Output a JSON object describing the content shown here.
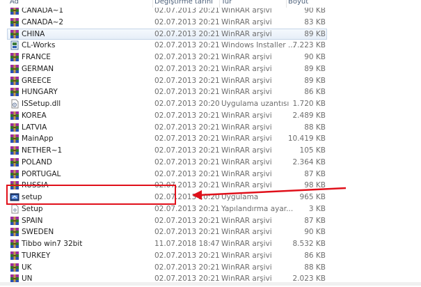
{
  "columns": {
    "name": "Ad",
    "date": "Değiştirme tarihi",
    "type": "Tür",
    "size": "Boyut"
  },
  "files": [
    {
      "name": "CANADA~1",
      "date": "02.07.2013 20:21",
      "type": "WinRAR arşivi",
      "size": "90 KB",
      "icon": "winrar-icon"
    },
    {
      "name": "CANADA~2",
      "date": "02.07.2013 20:21",
      "type": "WinRAR arşivi",
      "size": "83 KB",
      "icon": "winrar-icon"
    },
    {
      "name": "CHINA",
      "date": "02.07.2013 20:21",
      "type": "WinRAR arşivi",
      "size": "89 KB",
      "icon": "winrar-icon"
    },
    {
      "name": "CL-Works",
      "date": "02.07.2013 20:21",
      "type": "Windows Installer ...",
      "size": "7.223 KB",
      "icon": "installer-icon"
    },
    {
      "name": "FRANCE",
      "date": "02.07.2013 20:21",
      "type": "WinRAR arşivi",
      "size": "90 KB",
      "icon": "winrar-icon"
    },
    {
      "name": "GERMAN",
      "date": "02.07.2013 20:21",
      "type": "WinRAR arşivi",
      "size": "89 KB",
      "icon": "winrar-icon"
    },
    {
      "name": "GREECE",
      "date": "02.07.2013 20:21",
      "type": "WinRAR arşivi",
      "size": "89 KB",
      "icon": "winrar-icon"
    },
    {
      "name": "HUNGARY",
      "date": "02.07.2013 20:21",
      "type": "WinRAR arşivi",
      "size": "86 KB",
      "icon": "winrar-icon"
    },
    {
      "name": "ISSetup.dll",
      "date": "02.07.2013 20:20",
      "type": "Uygulama uzantısı",
      "size": "1.720 KB",
      "icon": "dll-icon"
    },
    {
      "name": "KOREA",
      "date": "02.07.2013 20:21",
      "type": "WinRAR arşivi",
      "size": "2.489 KB",
      "icon": "winrar-icon"
    },
    {
      "name": "LATVIA",
      "date": "02.07.2013 20:21",
      "type": "WinRAR arşivi",
      "size": "88 KB",
      "icon": "winrar-icon"
    },
    {
      "name": "MainApp",
      "date": "02.07.2013 20:21",
      "type": "WinRAR arşivi",
      "size": "10.419 KB",
      "icon": "winrar-icon"
    },
    {
      "name": "NETHER~1",
      "date": "02.07.2013 20:21",
      "type": "WinRAR arşivi",
      "size": "105 KB",
      "icon": "winrar-icon"
    },
    {
      "name": "POLAND",
      "date": "02.07.2013 20:21",
      "type": "WinRAR arşivi",
      "size": "2.364 KB",
      "icon": "winrar-icon"
    },
    {
      "name": "PORTUGAL",
      "date": "02.07.2013 20:21",
      "type": "WinRAR arşivi",
      "size": "87 KB",
      "icon": "winrar-icon"
    },
    {
      "name": "RUSSIA",
      "date": "02.07.2013 20:21",
      "type": "WinRAR arşivi",
      "size": "98 KB",
      "icon": "winrar-icon"
    },
    {
      "name": "setup",
      "date": "02.07.2013 20:20",
      "type": "Uygulama",
      "size": "965 KB",
      "icon": "setup-exe-icon"
    },
    {
      "name": "Setup",
      "date": "02.07.2013 20:21",
      "type": "Yapılandırma ayar...",
      "size": "3 KB",
      "icon": "config-file-icon"
    },
    {
      "name": "SPAIN",
      "date": "02.07.2013 20:21",
      "type": "WinRAR arşivi",
      "size": "87 KB",
      "icon": "winrar-icon"
    },
    {
      "name": "SWEDEN",
      "date": "02.07.2013 20:21",
      "type": "WinRAR arşivi",
      "size": "90 KB",
      "icon": "winrar-icon"
    },
    {
      "name": "Tibbo win7 32bit",
      "date": "11.07.2018 18:47",
      "type": "WinRAR arşivi",
      "size": "8.532 KB",
      "icon": "winrar-icon"
    },
    {
      "name": "TURKEY",
      "date": "02.07.2013 20:21",
      "type": "WinRAR arşivi",
      "size": "86 KB",
      "icon": "winrar-icon"
    },
    {
      "name": "UK",
      "date": "02.07.2013 20:21",
      "type": "WinRAR arşivi",
      "size": "88 KB",
      "icon": "winrar-icon"
    },
    {
      "name": "UN",
      "date": "02.07.2013 20:21",
      "type": "WinRAR arşivi",
      "size": "2.023 KB",
      "icon": "winrar-icon"
    }
  ],
  "selected_index": 2,
  "highlighted_index": 16,
  "colors": {
    "annotation": "#e0101a",
    "selection": "#e6eef8"
  }
}
